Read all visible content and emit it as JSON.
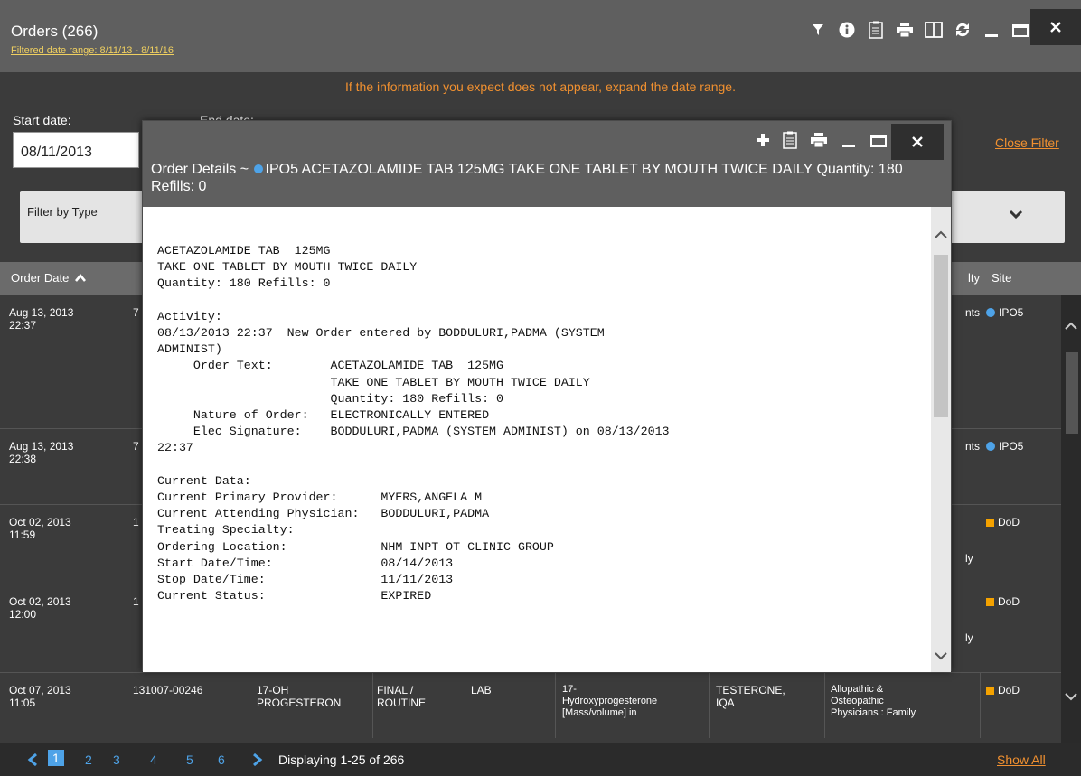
{
  "window": {
    "title": "Orders (266)",
    "subtitle": "Filtered date range: 8/11/13 - 8/11/16",
    "close_label": "×"
  },
  "notice": "If the information you expect does not appear, expand the date range.",
  "filters": {
    "start_label": "Start date:",
    "end_label": "End date:",
    "start_value": "08/11/2013",
    "close_filter": "Close Filter",
    "filter_type_label": "Filter by Type"
  },
  "table": {
    "headers": {
      "order_date": "Order Date",
      "col_specialty_tail": "lty",
      "site": "Site"
    },
    "rows": [
      {
        "date": "Aug 13, 2013\n22:37",
        "id": "7",
        "mid": "nts",
        "site": "IPO5",
        "site_type": "blue"
      },
      {
        "date": "Aug 13, 2013\n22:38",
        "id": "7",
        "mid": "nts",
        "site": "IPO5",
        "site_type": "blue"
      },
      {
        "date": "Oct 02, 2013\n11:59",
        "id": "1",
        "mid": "ly",
        "site": "DoD",
        "site_type": "orange"
      },
      {
        "date": "Oct 02, 2013\n12:00",
        "id": "1",
        "mid": "ly",
        "site": "DoD",
        "site_type": "orange"
      }
    ],
    "last_row": {
      "date": "Oct 07, 2013\n11:05",
      "id": "131007-00246",
      "test": "17-OH\nPROGESTERON",
      "status": "FINAL /\nROUTINE",
      "type": "LAB",
      "loinc": "17-\nHydroxyprogesterone\n[Mass/volume] in",
      "provider": "TESTERONE,\nIQA",
      "specialty": "Allopathic &\nOsteopathic\nPhysicians : Family",
      "site": "DoD"
    }
  },
  "footer": {
    "pages": [
      "1",
      "2",
      "3",
      "4",
      "5",
      "6"
    ],
    "display_info": "Displaying 1-25 of 266",
    "show_all": "Show All"
  },
  "modal": {
    "title_prefix": "Order Details ~",
    "title_rest": "IPO5 ACETAZOLAMIDE TAB 125MG TAKE ONE TABLET BY MOUTH TWICE DAILY Quantity: 180 Refills: 0",
    "close_label": "×",
    "body": "ACETAZOLAMIDE TAB  125MG\nTAKE ONE TABLET BY MOUTH TWICE DAILY\nQuantity: 180 Refills: 0\n\nActivity:\n08/13/2013 22:37  New Order entered by BODDULURI,PADMA (SYSTEM\nADMINIST)\n     Order Text:        ACETAZOLAMIDE TAB  125MG\n                        TAKE ONE TABLET BY MOUTH TWICE DAILY\n                        Quantity: 180 Refills: 0\n     Nature of Order:   ELECTRONICALLY ENTERED\n     Elec Signature:    BODDULURI,PADMA (SYSTEM ADMINIST) on 08/13/2013\n22:37\n\nCurrent Data:\nCurrent Primary Provider:      MYERS,ANGELA M\nCurrent Attending Physician:   BODDULURI,PADMA\nTreating Specialty:\nOrdering Location:             NHM INPT OT CLINIC GROUP\nStart Date/Time:               08/14/2013\nStop Date/Time:                11/11/2013\nCurrent Status:                EXPIRED"
  },
  "colors": {
    "accent_blue": "#4ea3e8",
    "accent_orange": "#f09030",
    "site_orange": "#f4a200",
    "titlebar": "#5f5f5f"
  },
  "icons": [
    "filter-icon",
    "info-icon",
    "clipboard-icon",
    "print-icon",
    "columns-icon",
    "refresh-icon",
    "minimize-icon",
    "maximize-icon",
    "close-icon",
    "plus-icon",
    "sort-up-icon",
    "chevron-down-icon",
    "chevron-left-icon",
    "chevron-right-icon"
  ]
}
